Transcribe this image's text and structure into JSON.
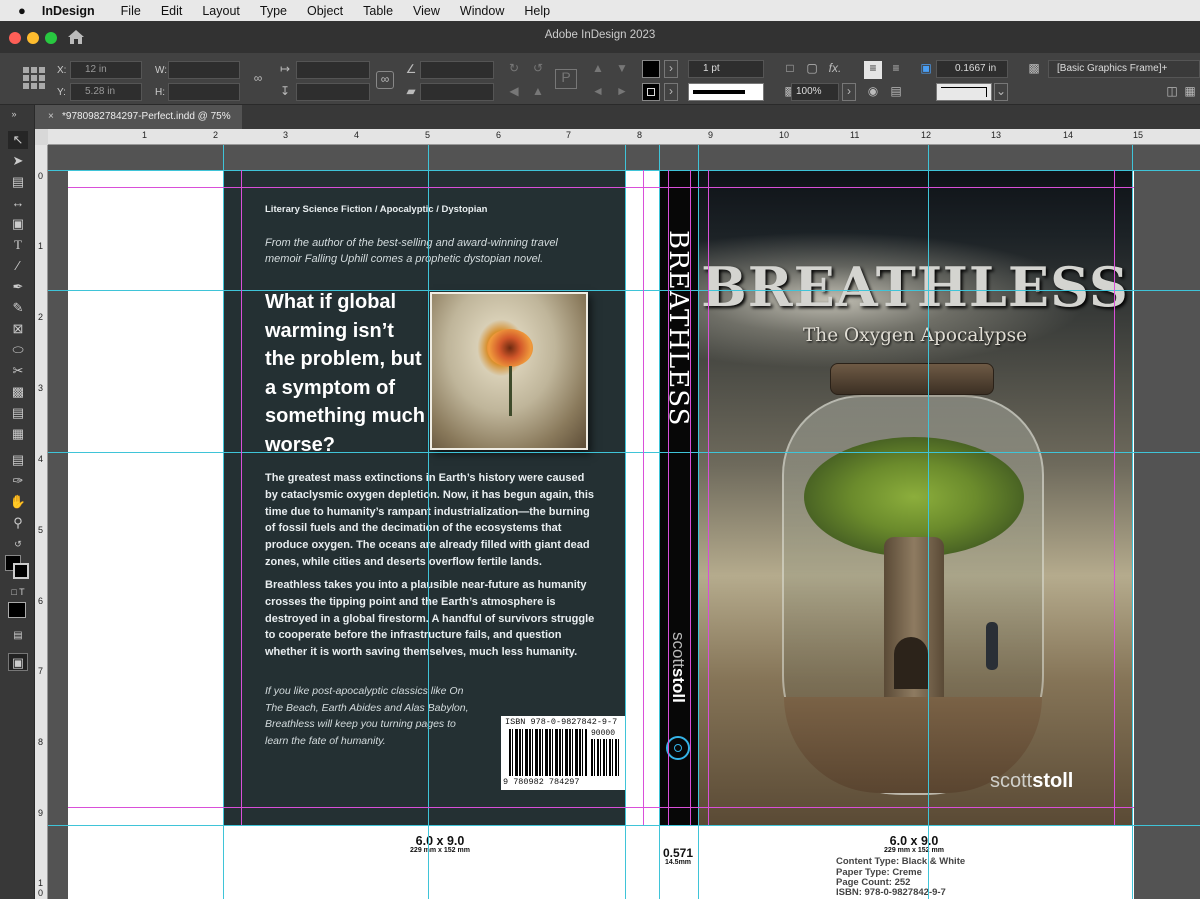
{
  "menubar": {
    "apple": "",
    "app_name": "InDesign",
    "items": [
      "File",
      "Edit",
      "Layout",
      "Type",
      "Object",
      "Table",
      "View",
      "Window",
      "Help"
    ]
  },
  "window": {
    "title": "Adobe InDesign 2023"
  },
  "control_panel": {
    "x_label": "X:",
    "x_value": "12 in",
    "y_label": "Y:",
    "y_value": "5.28 in",
    "w_label": "W:",
    "h_label": "H:",
    "stroke_weight": "1 pt",
    "scale": "100%",
    "fx": "fx.",
    "offset": "0.1667 in",
    "object_style": "[Basic Graphics Frame]+"
  },
  "document_tab": {
    "title": "*9780982784297-Perfect.indd @ 75%",
    "close": "×"
  },
  "ruler_h": [
    "1",
    "2",
    "3",
    "4",
    "5",
    "6",
    "7",
    "8",
    "9",
    "10",
    "11",
    "12",
    "13",
    "14",
    "15"
  ],
  "ruler_v": [
    "0",
    "1",
    "2",
    "3",
    "4",
    "5",
    "6",
    "7",
    "8",
    "9",
    "1",
    "0"
  ],
  "back_cover": {
    "genre": "Literary Science Fiction / Apocalyptic / Dystopian",
    "intro": "From the author of the best-selling and award-winning travel memoir Falling Uphill comes a prophetic dystopian novel.",
    "headline": "What if global warming isn’t the problem, but a symptom of something much worse?",
    "para1": "The greatest mass extinctions in Earth’s history were caused by cataclysmic oxygen depletion. Now, it has begun again, this time due to humanity’s rampant industrialization—the burning of fossil fuels and the decimation of the ecosystems that produce oxygen. The oceans are already filled with giant dead zones, while cities and deserts overflow fertile lands.",
    "para2": "Breathless takes you into a plausible near-future as humanity crosses the tipping point and the Earth’s atmosphere is destroyed in a global firestorm. A handful of survivors struggle to cooperate before the infrastructure fails, and question whether it is worth saving themselves, much less humanity.",
    "closing": "If you like post-apocalyptic classics like On The Beach, Earth Abides and Alas Babylon, Breathless will keep you turning pages to learn the fate of humanity.",
    "isbn_top": "ISBN 978-0-9827842-9-7",
    "barcode_digits": "9 780982 784297",
    "price_code": "90000"
  },
  "spine": {
    "title": "BREATHLESS",
    "author_a": "scott",
    "author_b": "stoll"
  },
  "front_cover": {
    "title": "BREATHLESS",
    "subtitle": "The Oxygen Apocalypse",
    "author_a": "scott",
    "author_b": "stoll"
  },
  "slug": {
    "back_size": "6.0 x 9.0",
    "back_mm": "229 mm x 152 mm",
    "spine_in": "0.571",
    "spine_mm": "14.5mm",
    "front_size": "6.0 x 9.0",
    "front_mm": "229 mm x 152 mm",
    "content_type": "Content Type: Black & White",
    "paper_type": "Paper Type: Creme",
    "page_count": "Page Count: 252",
    "isbn": "ISBN: 978-0-9827842-9-7"
  }
}
